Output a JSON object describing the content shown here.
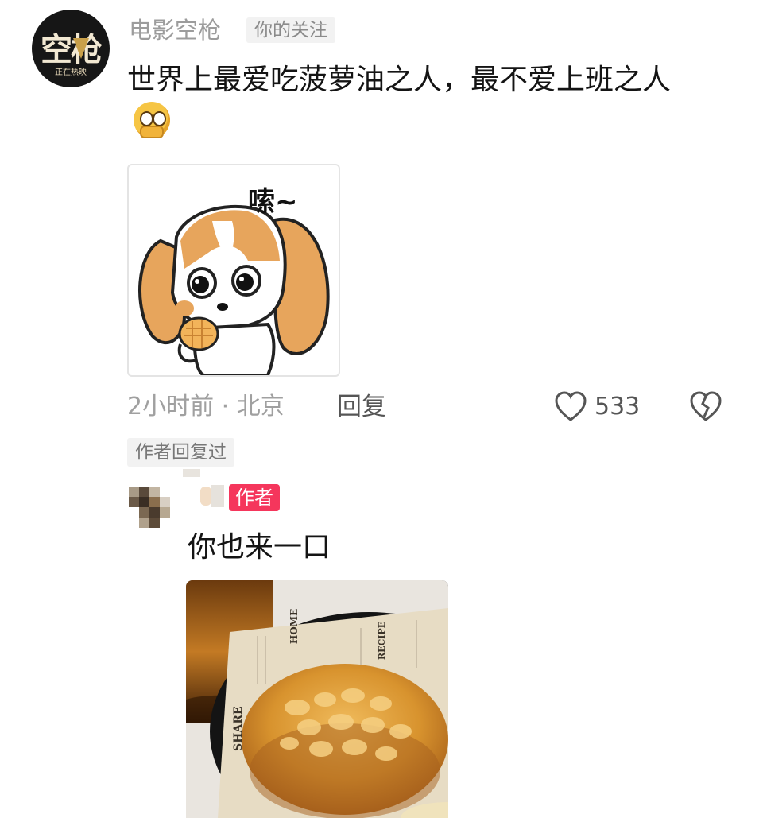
{
  "comment": {
    "username": "电影空枪",
    "follow_badge": "你的关注",
    "avatar": {
      "logo_text": "空枪",
      "logo_sub": "正在热映"
    },
    "text": "世界上最爱吃菠萝油之人，最不爱上班之人",
    "emoji": "thinking-face-icon",
    "sticker": {
      "caption": "嗦~"
    },
    "time_location": "2小时前 · 北京",
    "reply_label": "回复",
    "like_count": "533",
    "author_replied_badge": "作者回复过"
  },
  "reply": {
    "author_badge": "作者",
    "text": "你也来一口"
  },
  "colors": {
    "accent_badge": "#f5365c",
    "muted_text": "#a0a0a0",
    "badge_bg": "#f2f2f2"
  }
}
